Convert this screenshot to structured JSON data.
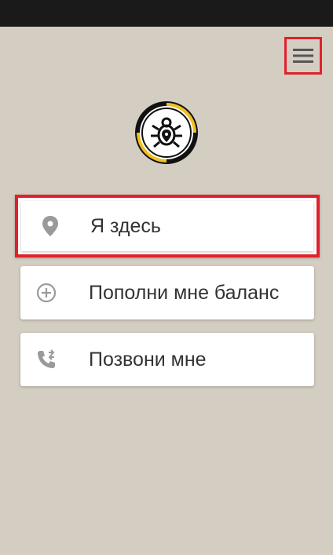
{
  "header": {
    "menu_icon": "hamburger-menu-icon"
  },
  "logo": {
    "icon": "bug-location-logo",
    "colors": {
      "ring": "#f0c020",
      "border": "#111111",
      "fill": "#ffffff"
    }
  },
  "actions": [
    {
      "label": "Я здесь",
      "icon": "location-pin-icon",
      "highlighted": true
    },
    {
      "label": "Пополни мне баланс",
      "icon": "add-circle-icon",
      "highlighted": false
    },
    {
      "label": "Позвони мне",
      "icon": "phone-forward-icon",
      "highlighted": false
    }
  ],
  "colors": {
    "background": "#d4cdc1",
    "highlight": "#e0202a",
    "icon": "#9a9a9a",
    "text": "#333333"
  }
}
